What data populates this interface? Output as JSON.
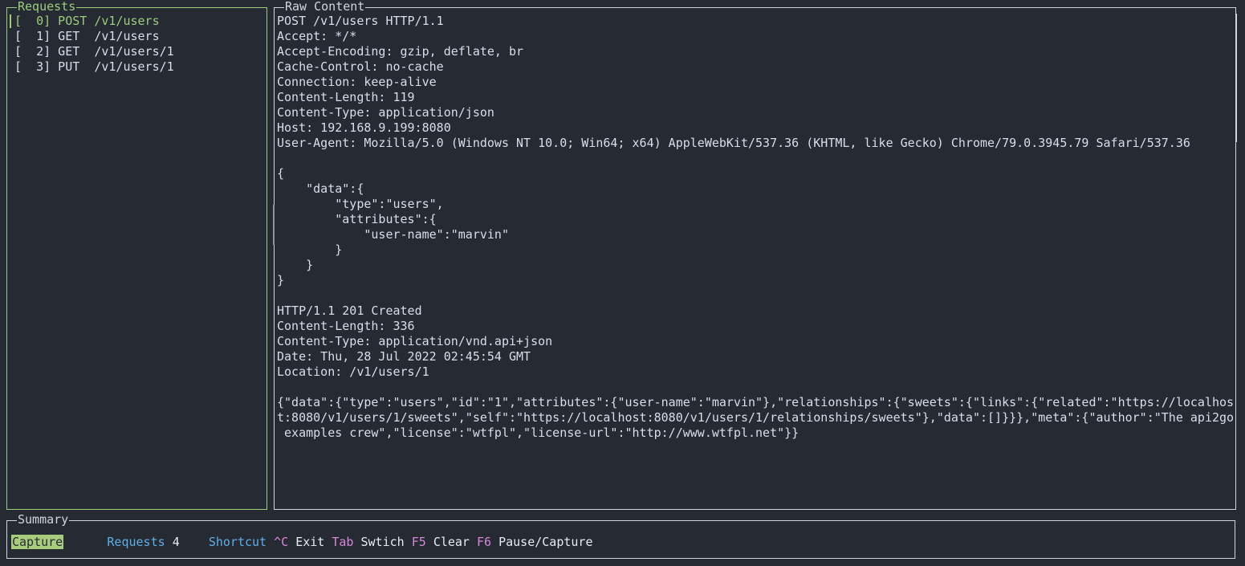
{
  "panels": {
    "requests": {
      "title": "Requests",
      "focused": true
    },
    "raw": {
      "title": "Raw Content",
      "focused": false
    },
    "summary": {
      "title": "Summary",
      "focused": false
    }
  },
  "requests": {
    "items": [
      {
        "row": "[  0] POST /v1/users",
        "index": "0",
        "method": "POST",
        "path": "/v1/users",
        "selected": true
      },
      {
        "row": "[  1] GET  /v1/users",
        "index": "1",
        "method": "GET",
        "path": "/v1/users",
        "selected": false
      },
      {
        "row": "[  2] GET  /v1/users/1",
        "index": "2",
        "method": "GET",
        "path": "/v1/users/1",
        "selected": false
      },
      {
        "row": "[  3] PUT  /v1/users/1",
        "index": "3",
        "method": "PUT",
        "path": "/v1/users/1",
        "selected": false
      }
    ]
  },
  "raw_content": {
    "lines": [
      "POST /v1/users HTTP/1.1",
      "Accept: */*",
      "Accept-Encoding: gzip, deflate, br",
      "Cache-Control: no-cache",
      "Connection: keep-alive",
      "Content-Length: 119",
      "Content-Type: application/json",
      "Host: 192.168.9.199:8080",
      "User-Agent: Mozilla/5.0 (Windows NT 10.0; Win64; x64) AppleWebKit/537.36 (KHTML, like Gecko) Chrome/79.0.3945.79 Safari/537.36",
      "",
      "{",
      "    \"data\":{",
      "        \"type\":\"users\",",
      "        \"attributes\":{",
      "            \"user-name\":\"marvin\"",
      "        }",
      "    }",
      "}",
      "",
      "HTTP/1.1 201 Created",
      "Content-Length: 336",
      "Content-Type: application/vnd.api+json",
      "Date: Thu, 28 Jul 2022 02:45:54 GMT",
      "Location: /v1/users/1",
      "",
      "{\"data\":{\"type\":\"users\",\"id\":\"1\",\"attributes\":{\"user-name\":\"marvin\"},\"relationships\":{\"sweets\":{\"links\":{\"related\":\"https://localhos",
      "t:8080/v1/users/1/sweets\",\"self\":\"https://localhost:8080/v1/users/1/relationships/sweets\"},\"data\":[]}}},\"meta\":{\"author\":\"The api2go",
      " examples crew\",\"license\":\"wtfpl\",\"license-url\":\"http://www.wtfpl.net\"}}"
    ]
  },
  "summary": {
    "capture_badge": "Capture",
    "requests_label": "Requests",
    "requests_count": "4",
    "shortcut_label": "Shortcut",
    "shortcuts": [
      {
        "key": "^C",
        "action": "Exit"
      },
      {
        "key": "Tab",
        "action": "Swtich"
      },
      {
        "key": "F5",
        "action": "Clear"
      },
      {
        "key": "F6",
        "action": "Pause/Capture"
      }
    ]
  },
  "colors": {
    "background": "#262b33",
    "foreground": "#d8dee9",
    "focus_green": "#9ccc7c",
    "badge_green": "#a9cc7c",
    "accent_blue": "#5fafe7",
    "key_magenta": "#d787d7",
    "border": "#cfd6de"
  }
}
